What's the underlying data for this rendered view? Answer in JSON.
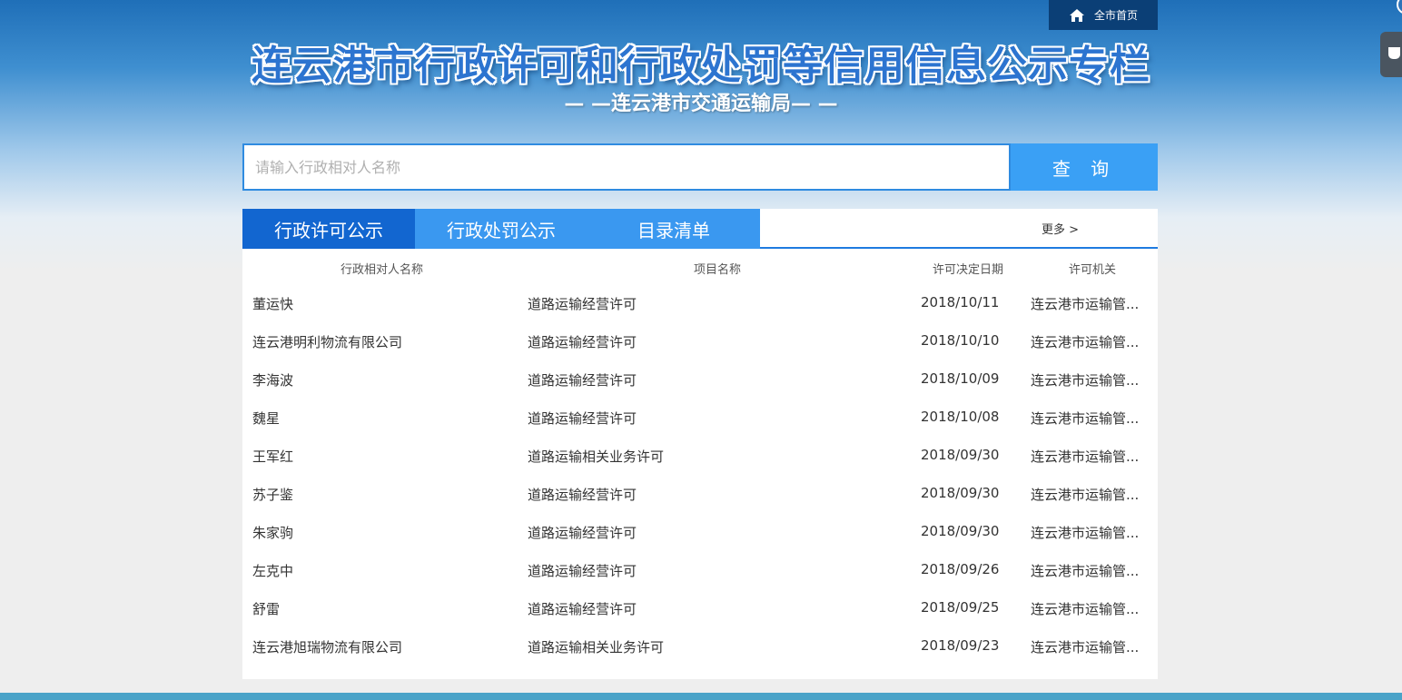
{
  "header": {
    "home_label": "全市首页",
    "title": "连云港市行政许可和行政处罚等信用信息公示专栏",
    "subtitle": "— —连云港市交通运输局— —"
  },
  "search": {
    "placeholder": "请输入行政相对人名称",
    "button_label": "查 询"
  },
  "tabs": [
    {
      "label": "行政许可公示",
      "active": true
    },
    {
      "label": "行政处罚公示",
      "active": false
    },
    {
      "label": "目录清单",
      "active": false
    }
  ],
  "more_label": "更多 >",
  "table": {
    "headers": [
      "行政相对人名称",
      "项目名称",
      "许可决定日期",
      "许可机关"
    ],
    "rows": [
      [
        "董运快",
        "道路运输经营许可",
        "2018/10/11",
        "连云港市运输管..."
      ],
      [
        "连云港明利物流有限公司",
        "道路运输经营许可",
        "2018/10/10",
        "连云港市运输管..."
      ],
      [
        "李海波",
        "道路运输经营许可",
        "2018/10/09",
        "连云港市运输管..."
      ],
      [
        "魏星",
        "道路运输经营许可",
        "2018/10/08",
        "连云港市运输管..."
      ],
      [
        "王军红",
        "道路运输相关业务许可",
        "2018/09/30",
        "连云港市运输管..."
      ],
      [
        "苏子鉴",
        "道路运输经营许可",
        "2018/09/30",
        "连云港市运输管..."
      ],
      [
        "朱家驹",
        "道路运输经营许可",
        "2018/09/30",
        "连云港市运输管..."
      ],
      [
        "左克中",
        "道路运输经营许可",
        "2018/09/26",
        "连云港市运输管..."
      ],
      [
        "舒雷",
        "道路运输经营许可",
        "2018/09/25",
        "连云港市运输管..."
      ],
      [
        "连云港旭瑞物流有限公司",
        "道路运输相关业务许可",
        "2018/09/23",
        "连云港市运输管..."
      ]
    ]
  },
  "colors": {
    "title": "#2c74d0",
    "tab_active": "#1266d0",
    "tab": "#3a98f0",
    "search_button": "#3aa0f5"
  }
}
